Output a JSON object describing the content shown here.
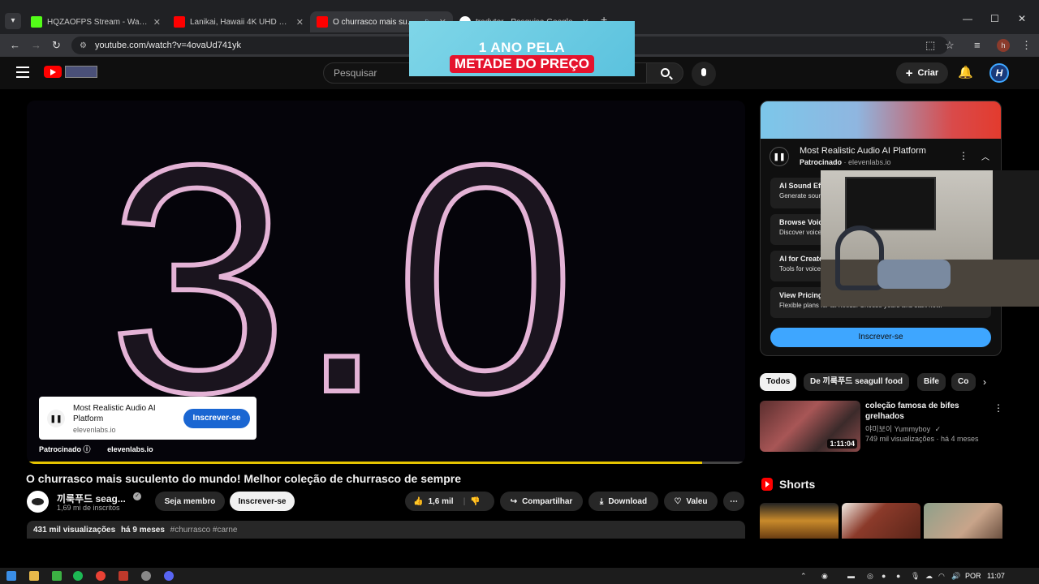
{
  "browser": {
    "tabs": [
      {
        "title": "HQZAOFPS Stream - Watch Live",
        "favicon_color": "#53fc18"
      },
      {
        "title": "Lanikai, Hawaii 4K UHD – Pristine",
        "favicon_color": "#ff0000"
      },
      {
        "title": "O churrasco mais suculento",
        "favicon_color": "#ff0000"
      },
      {
        "title": "tradutor - Pesquisa Google",
        "favicon_color": "#ffffff"
      }
    ],
    "url": "youtube.com/watch?v=4ovaUd741yk",
    "profile_letter": "h"
  },
  "header": {
    "search_placeholder": "Pesquisar",
    "create_label": "Criar",
    "avatar_letter": "H"
  },
  "promo": {
    "line1": "1 ANO PELA",
    "line2": "METADE DO PREÇO"
  },
  "player": {
    "overlay_text": "3.0",
    "progress_percent": 94,
    "ad": {
      "title": "Most Realistic Audio AI Platform",
      "domain": "elevenlabs.io",
      "subscribe": "Inscrever-se",
      "sponsored": "Patrocinado",
      "footer_domain": "elevenlabs.io"
    }
  },
  "video": {
    "title": "O churrasco mais suculento do mundo! Melhor coleção de churrasco de sempre",
    "channel": "끼룩푸드 seag...",
    "subscribers": "1,69 mi de inscritos",
    "member_btn": "Seja membro",
    "subscribe_btn": "Inscrever-se",
    "likes": "1,6 mil",
    "share": "Compartilhar",
    "download": "Download",
    "thanks": "Valeu",
    "views": "431 mil visualizações",
    "date": "há 9 meses",
    "tags": "#churrasco #carne"
  },
  "sponsored_panel": {
    "title": "Most Realistic Audio AI Platform",
    "sponsored": "Patrocinado",
    "domain": "elevenlabs.io",
    "items": [
      {
        "title": "AI Sound Effects",
        "desc": "Generate sound effects with AI"
      },
      {
        "title": "Browse Voices",
        "desc": "Discover voices for any project"
      },
      {
        "title": "AI for Creators",
        "desc": "Tools for voice creators"
      },
      {
        "title": "View Pricing",
        "desc": "Flexible plans for all needs. Choose yours and start now."
      }
    ],
    "subscribe": "Inscrever-se"
  },
  "chips": [
    "Todos",
    "De 끼룩푸드 seagull food",
    "Bife",
    "Co"
  ],
  "recommendation": {
    "title": "coleção famosa de bifes grelhados",
    "channel": "야미보이 Yummyboy",
    "meta": "749 mil visualizações · há 4 meses",
    "duration": "1:11:04"
  },
  "shorts": {
    "title": "Shorts"
  },
  "taskbar": {
    "lang": "POR",
    "time": "11:07"
  },
  "colors": {
    "yt_red": "#ff0000",
    "progress": "#e6c400",
    "link_blue": "#3ea6ff",
    "countdown_stroke": "#e4b3d6"
  }
}
